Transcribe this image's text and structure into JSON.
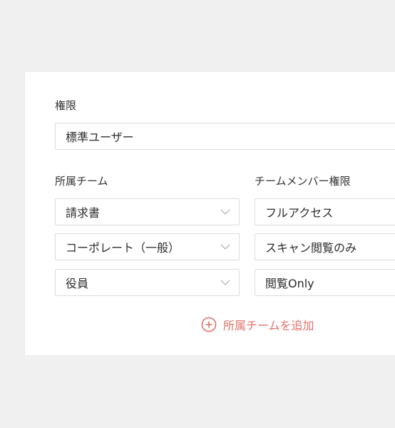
{
  "permission": {
    "label": "権限",
    "value": "標準ユーザー"
  },
  "teams": {
    "team_header": "所属チーム",
    "member_permission_header": "チームメンバー権限",
    "rows": [
      {
        "team": "請求書",
        "permission": "フルアクセス"
      },
      {
        "team": "コーポレート（一般）",
        "permission": "スキャン閲覧のみ"
      },
      {
        "team": "役員",
        "permission": "閲覧Only"
      }
    ]
  },
  "add_team": {
    "label": "所属チームを追加"
  },
  "colors": {
    "accent": "#e07268",
    "border": "#dcdcdc",
    "background": "#f0f0f1",
    "card": "#ffffff"
  },
  "icons": {
    "dropdown": "chevron-down-icon",
    "add": "plus-circle-icon"
  }
}
